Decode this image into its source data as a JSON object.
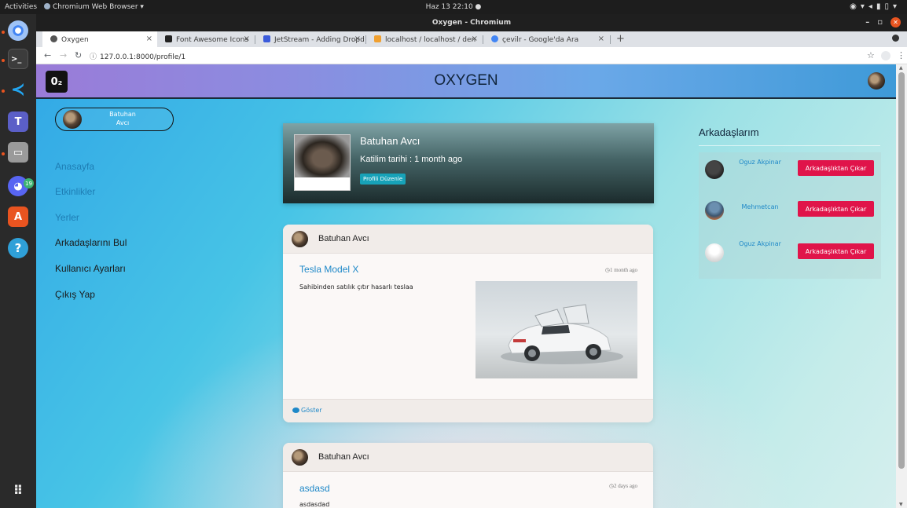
{
  "os": {
    "activities": "Activities",
    "app_menu": "Chromium Web Browser ▾",
    "clock": "Haz 13  22:10  ●",
    "discord_badge": "19",
    "dock_icons": [
      "chromium-icon",
      "terminal-icon",
      "vscode-icon",
      "teams-icon",
      "files-icon",
      "discord-icon",
      "software-store-icon",
      "help-icon",
      "app-grid-icon"
    ]
  },
  "browser": {
    "window_title": "Oxygen - Chromium",
    "tabs": [
      {
        "label": "Oxygen",
        "active": true
      },
      {
        "label": "Font Awesome Icons",
        "active": false
      },
      {
        "label": "JetStream - Adding Dropd",
        "active": false
      },
      {
        "label": "localhost / localhost / den",
        "active": false
      },
      {
        "label": "çevilr - Google'da Ara",
        "active": false
      }
    ],
    "new_tab": "+",
    "url": "127.0.0.1:8000/profile/1"
  },
  "site": {
    "logo": "0₂",
    "brand": "OXYGEN"
  },
  "sidebar": {
    "user_name": "Batuhan Avcı",
    "items": [
      {
        "label": "Anasayfa",
        "tone": "light"
      },
      {
        "label": "Etkinlikler",
        "tone": "light"
      },
      {
        "label": "Yerler",
        "tone": "light"
      },
      {
        "label": "Arkadaşlarını Bul",
        "tone": "dark"
      },
      {
        "label": "Kullanıcı Ayarları",
        "tone": "dark"
      },
      {
        "label": "Çıkış Yap",
        "tone": "dark"
      }
    ]
  },
  "profile": {
    "name": "Batuhan Avcı",
    "joined": "Katilim tarihi : 1 month ago",
    "edit_label": "Profili Düzenle"
  },
  "posts": [
    {
      "author": "Batuhan Avcı",
      "title": "Tesla Model X",
      "time": "1 month ago",
      "body": "Sahibinden satılık çıtır hasarlı teslaa",
      "show_label": "Göster"
    },
    {
      "author": "Batuhan Avcı",
      "title": "asdasd",
      "time": "2 days ago",
      "body": "asdasdad"
    }
  ],
  "friends": {
    "title": "Arkadaşlarım",
    "list": [
      {
        "name": "Oguz Akpinar",
        "button": "Arkadaşlıktan Çıkar"
      },
      {
        "name": "Mehmetcan",
        "button": "Arkadaşlıktan Çıkar"
      },
      {
        "name": "Oguz Akpinar",
        "button": "Arkadaşlıktan Çıkar"
      }
    ]
  },
  "colors": {
    "accent": "#17a2b8",
    "danger": "#e0144a",
    "link": "#1e88c8"
  }
}
